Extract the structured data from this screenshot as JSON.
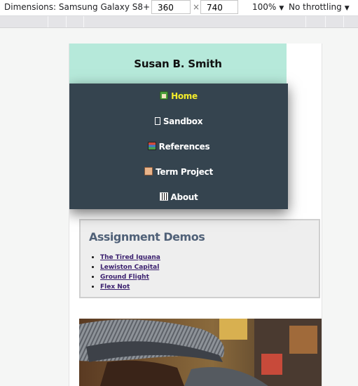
{
  "devtools": {
    "dimensions_label": "Dimensions: Samsung Galaxy S8+",
    "width_value": "360",
    "times": "×",
    "height_value": "740",
    "zoom": "100%",
    "throttling": "No throttling"
  },
  "site": {
    "title": "Susan B. Smith",
    "nav": [
      {
        "label": "Home",
        "icon": "house-icon",
        "active": true
      },
      {
        "label": "Sandbox",
        "icon": "box-icon",
        "active": false
      },
      {
        "label": "References",
        "icon": "books-icon",
        "active": false
      },
      {
        "label": "Term Project",
        "icon": "scroll-icon",
        "active": false
      },
      {
        "label": "About",
        "icon": "piano-icon",
        "active": false
      }
    ],
    "demos": {
      "heading": "Assignment Demos",
      "links": [
        "The Tired Iguana",
        "Lewiston Capital",
        "Ground Flight",
        "Flex Not"
      ]
    },
    "photo": {
      "subject": "person wearing a striped hat"
    }
  }
}
